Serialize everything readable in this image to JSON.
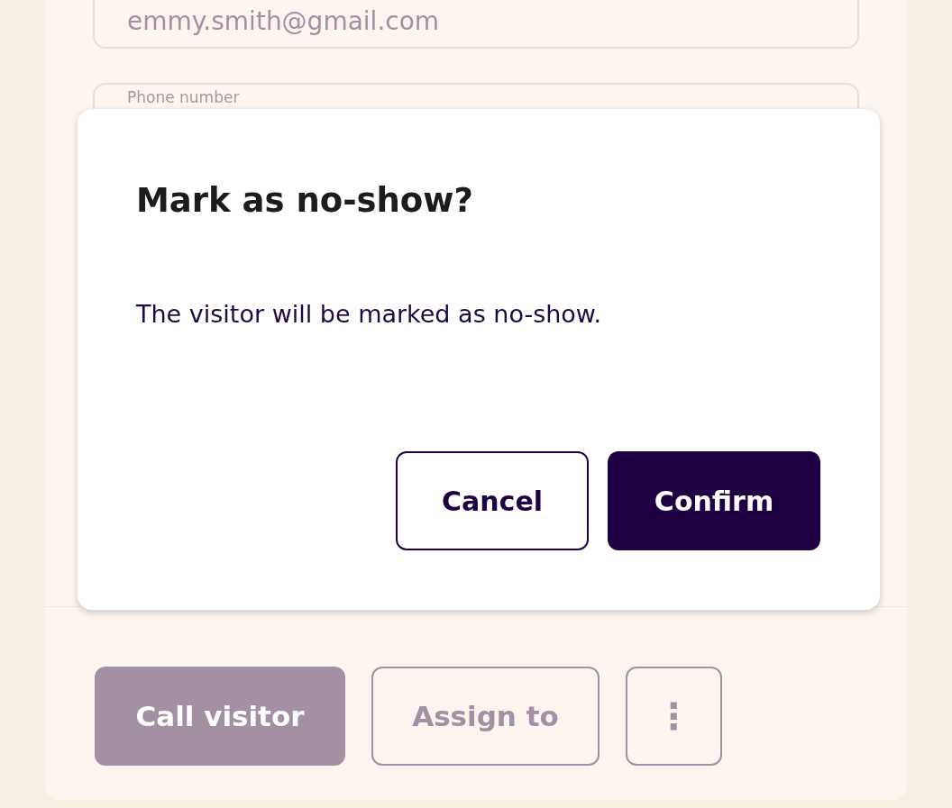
{
  "form": {
    "fields": [
      {
        "kind": "email",
        "value": "emmy.smith@gmail.com"
      },
      {
        "kind": "phone",
        "placeholder": "Phone number"
      }
    ]
  },
  "actions": [
    {
      "kind": "primary",
      "label": "Call visitor"
    },
    {
      "kind": "outline",
      "label": "Assign to"
    },
    {
      "kind": "more",
      "label": "⋮"
    }
  ],
  "dialog": {
    "title": "Mark as no-show?",
    "message": "The visitor will be marked as no-show.",
    "buttons": [
      {
        "kind": "outline",
        "label": "Cancel"
      },
      {
        "kind": "primary",
        "label": "Confirm"
      }
    ]
  }
}
